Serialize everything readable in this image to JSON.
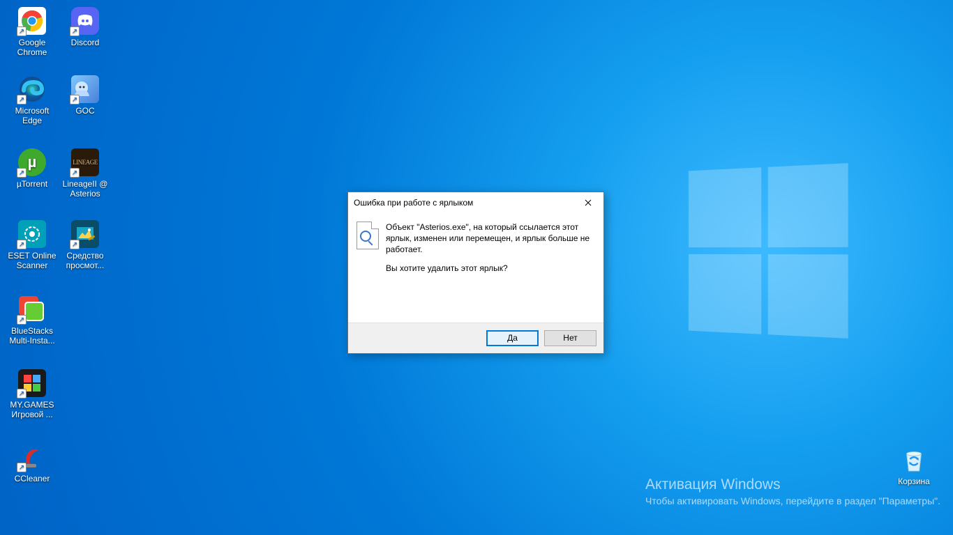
{
  "desktop": {
    "col1": [
      {
        "label": "Google Chrome"
      },
      {
        "label": "Microsoft Edge"
      },
      {
        "label": "µTorrent"
      },
      {
        "label": "ESET Online Scanner"
      },
      {
        "label": "BlueStacks Multi-Insta..."
      },
      {
        "label": "MY.GAMES Игровой ..."
      },
      {
        "label": "CCleaner"
      }
    ],
    "col2": [
      {
        "label": "Discord"
      },
      {
        "label": "GOC"
      },
      {
        "label": "LineageII @ Asterios"
      },
      {
        "label": "Средство просмот..."
      }
    ],
    "recycle": {
      "label": "Корзина"
    }
  },
  "dialog": {
    "title": "Ошибка при работе с ярлыком",
    "msg1": "Объект \"Asterios.exe\", на который ссылается этот ярлык, изменен или перемещен, и ярлык больше не работает.",
    "msg2": "Вы хотите удалить этот ярлык?",
    "yes": "Да",
    "no": "Нет"
  },
  "watermark": {
    "title": "Активация Windows",
    "sub": "Чтобы активировать Windows, перейдите в раздел \"Параметры\"."
  }
}
